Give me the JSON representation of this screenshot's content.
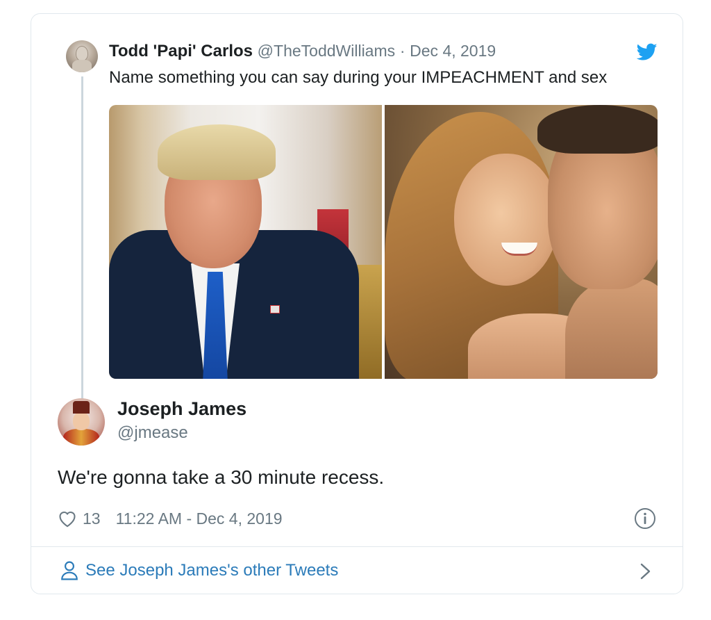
{
  "parent_tweet": {
    "name": "Todd 'Papi' Carlos",
    "handle": "@TheToddWilliams",
    "separator": "·",
    "date": "Dec 4, 2019",
    "text": "Name something you can say during your IMPEACHMENT and sex",
    "icons": {
      "avatar": "avatar-icon",
      "brand": "twitter-bird-icon"
    }
  },
  "reply_tweet": {
    "name": "Joseph James",
    "handle": "@jmease",
    "text": "We're gonna take a 30 minute recess.",
    "like_count": "13",
    "timestamp": "11:22 AM - Dec 4, 2019",
    "icons": {
      "like": "heart-icon",
      "info": "info-icon"
    }
  },
  "footer": {
    "link_text": "See Joseph James's other Tweets",
    "icons": {
      "person": "person-icon",
      "chevron": "chevron-right-icon"
    }
  },
  "colors": {
    "brand_blue": "#1da1f2",
    "link_blue": "#2b7bb9",
    "secondary_text": "#697882",
    "primary_text": "#1c2022",
    "border": "#e1e8ed"
  }
}
